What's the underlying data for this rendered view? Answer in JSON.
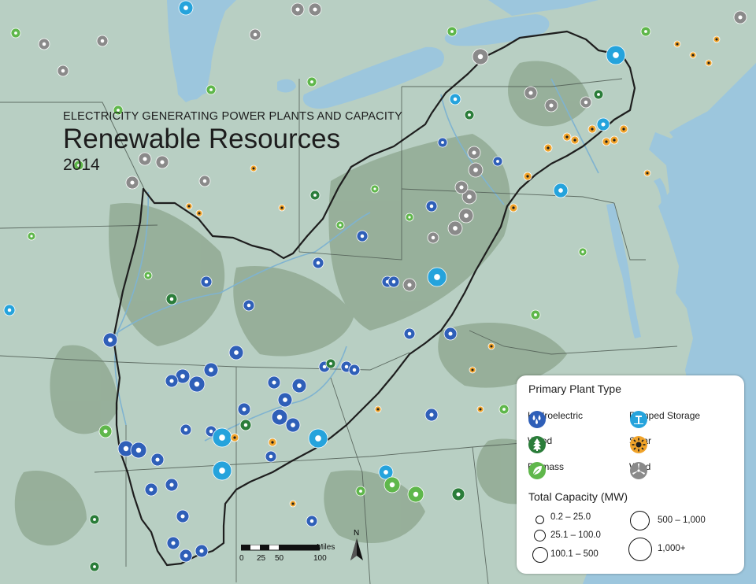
{
  "title": {
    "supertitle": "ELECTRICITY GENERATING POWER PLANTS AND CAPACITY",
    "main": "Renewable Resources",
    "year": "2014"
  },
  "legend": {
    "plant_type_heading": "Primary Plant Type",
    "plant_types": [
      {
        "label": "Hydroelectric",
        "icon": "raindrops-icon",
        "color": "#2f5fb8"
      },
      {
        "label": "Pumped Storage",
        "icon": "water-tower-icon",
        "color": "#25a3dc"
      },
      {
        "label": "Wood",
        "icon": "tree-icon",
        "color": "#2b7d3a"
      },
      {
        "label": "Solar",
        "icon": "sun-icon",
        "color": "#f0a32a"
      },
      {
        "label": "Biomass",
        "icon": "leaf-icon",
        "color": "#5fb74b"
      },
      {
        "label": "Wind",
        "icon": "turbine-icon",
        "color": "#8a8a8a"
      }
    ],
    "capacity_heading": "Total Capacity (MW)",
    "capacity_classes": [
      "0.2 – 25.0",
      "25.1 – 100.0",
      "100.1 – 500",
      "500 – 1,000",
      "1,000+"
    ]
  },
  "scalebar": {
    "unit": "Miles",
    "ticks": [
      "0",
      "25",
      "50",
      "100"
    ]
  },
  "north_label": "N",
  "colors": {
    "water": "#9cc6dd",
    "land": "#b9cfc4",
    "forest": "#7f9a80",
    "region_border": "#222222",
    "state_border": "#4e5a52"
  }
}
